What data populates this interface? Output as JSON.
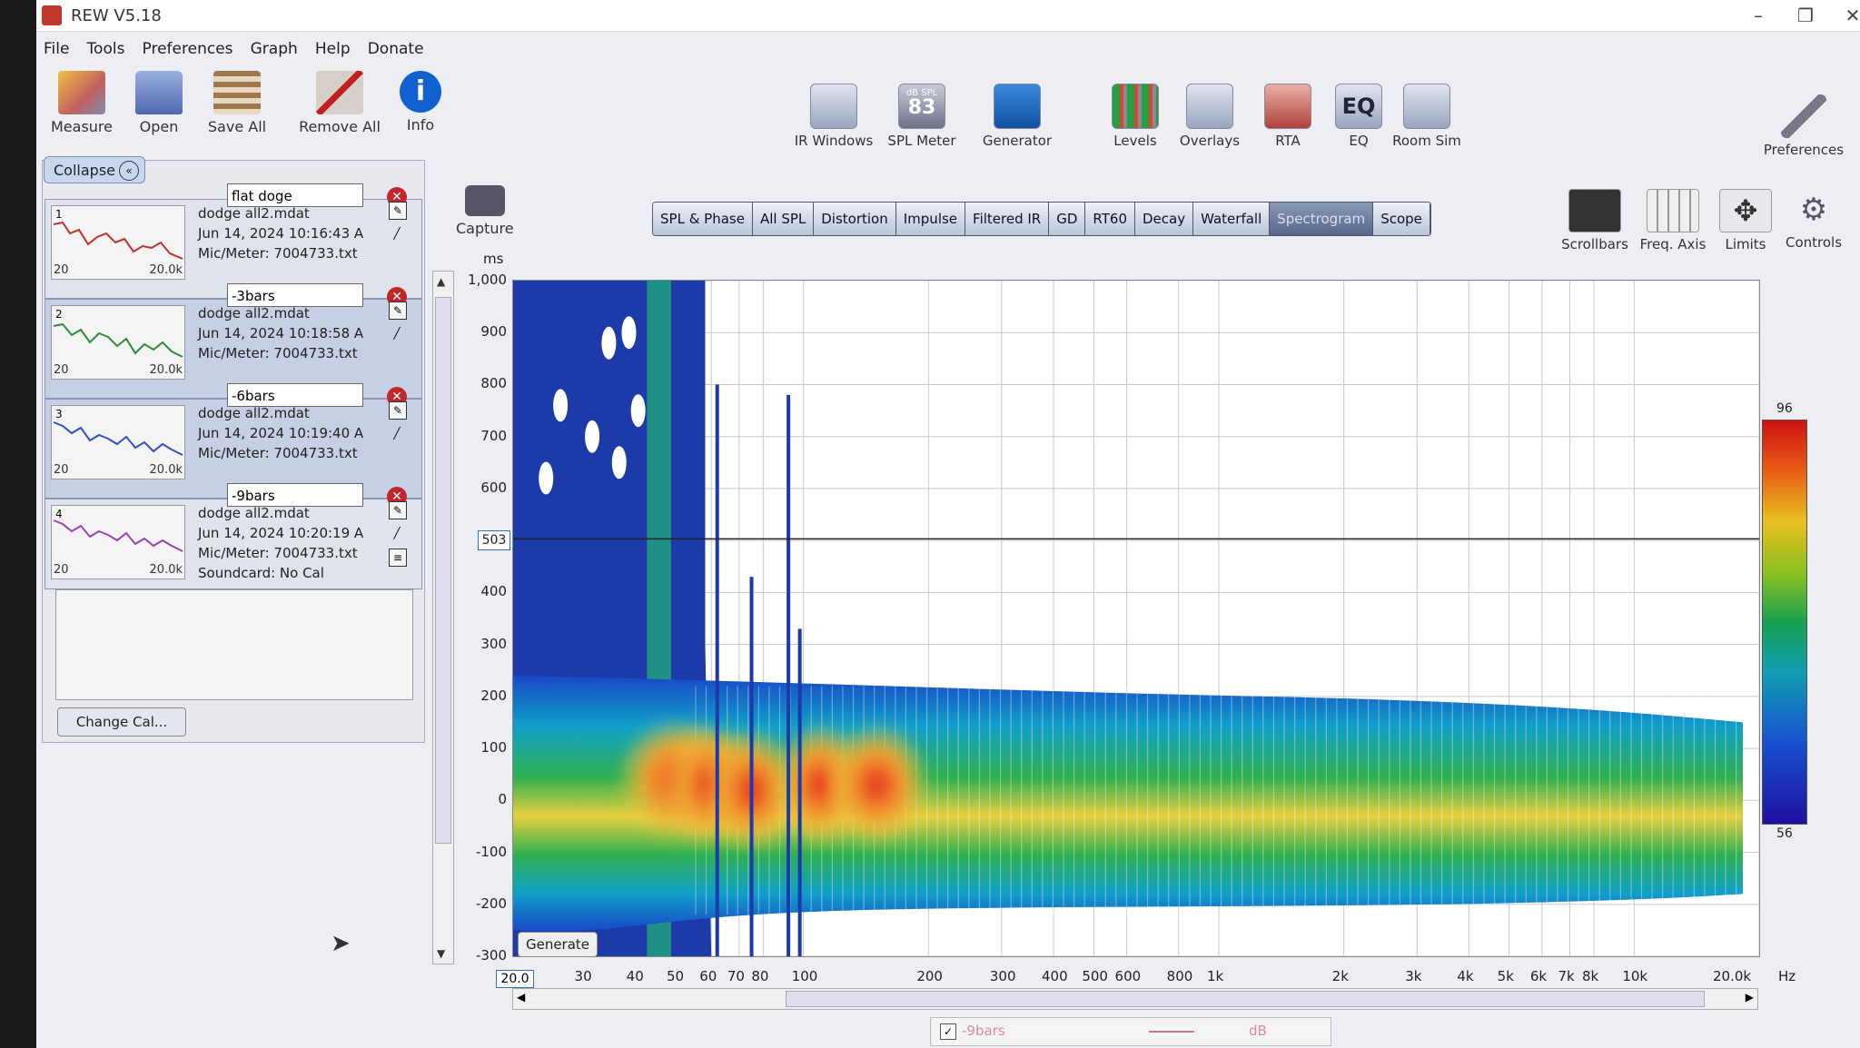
{
  "window": {
    "title": "REW V5.18"
  },
  "menu": [
    "File",
    "Tools",
    "Preferences",
    "Graph",
    "Help",
    "Donate"
  ],
  "toolbar_left": [
    {
      "label": "Measure",
      "icon": "measure-icon"
    },
    {
      "label": "Open",
      "icon": "folder-icon"
    },
    {
      "label": "Save All",
      "icon": "save-icon"
    },
    {
      "label": "Remove All",
      "icon": "remove-icon"
    },
    {
      "label": "Info",
      "icon": "info-icon"
    }
  ],
  "toolbar_tools": [
    {
      "label": "IR Windows",
      "icon": "ir-windows-icon"
    },
    {
      "label": "SPL Meter",
      "icon": "spl-meter-icon",
      "badge_top": "dB SPL",
      "badge_value": "83"
    },
    {
      "label": "Generator",
      "icon": "generator-icon"
    },
    {
      "label": "Levels",
      "icon": "levels-icon"
    },
    {
      "label": "Overlays",
      "icon": "overlays-icon"
    },
    {
      "label": "RTA",
      "icon": "rta-icon"
    },
    {
      "label": "EQ",
      "icon": "eq-icon",
      "badge_value": "EQ"
    },
    {
      "label": "Room Sim",
      "icon": "room-sim-icon"
    }
  ],
  "preferences_label": "Preferences",
  "collapse_label": "Collapse",
  "measurements": [
    {
      "num": "1",
      "name": "flat doge",
      "file": "dodge all2.mdat",
      "date": "Jun 14, 2024 10:16:43 A",
      "mic": "Mic/Meter: 7004733.txt",
      "trace": "#c03030",
      "xmin": "20",
      "xmax": "20.0k"
    },
    {
      "num": "2",
      "name": "-3bars",
      "file": "dodge all2.mdat",
      "date": "Jun 14, 2024 10:18:58 A",
      "mic": "Mic/Meter: 7004733.txt",
      "trace": "#2f8a3a",
      "xmin": "20",
      "xmax": "20.0k"
    },
    {
      "num": "3",
      "name": "-6bars",
      "file": "dodge all2.mdat",
      "date": "Jun 14, 2024 10:19:40 A",
      "mic": "Mic/Meter: 7004733.txt",
      "trace": "#3050c0",
      "xmin": "20",
      "xmax": "20.0k"
    },
    {
      "num": "4",
      "name": "-9bars",
      "file": "dodge all2.mdat",
      "date": "Jun 14, 2024 10:20:19 A",
      "mic": "Mic/Meter: 7004733.txt",
      "soundcard": "Soundcard: No Cal",
      "trace": "#9a40b0",
      "xmin": "20",
      "xmax": "20.0k"
    }
  ],
  "change_cal_label": "Change Cal...",
  "capture_label": "Capture",
  "graph_tabs": [
    {
      "label": "SPL & Phase",
      "active": false
    },
    {
      "label": "All SPL",
      "active": false
    },
    {
      "label": "Distortion",
      "active": false
    },
    {
      "label": "Impulse",
      "active": false
    },
    {
      "label": "Filtered IR",
      "active": false
    },
    {
      "label": "GD",
      "active": false
    },
    {
      "label": "RT60",
      "active": false
    },
    {
      "label": "Decay",
      "active": false
    },
    {
      "label": "Waterfall",
      "active": false
    },
    {
      "label": "Spectrogram",
      "active": true
    },
    {
      "label": "Scope",
      "active": false
    }
  ],
  "graph_controls": [
    {
      "label": "Scrollbars",
      "icon": "scrollbars-icon"
    },
    {
      "label": "Freq. Axis",
      "icon": "freq-axis-icon"
    },
    {
      "label": "Limits",
      "icon": "limits-icon"
    },
    {
      "label": "Controls",
      "icon": "gear-icon"
    }
  ],
  "generate_label": "Generate",
  "colors": {
    "accent": "#3070c0",
    "delete": "#c0262b",
    "active_tab": "#56668a"
  },
  "chart_data": {
    "type": "heatmap",
    "y_unit": "ms",
    "x_unit": "Hz",
    "x_scale": "log",
    "xlim": [
      20,
      20000
    ],
    "ylim": [
      -300,
      1000
    ],
    "y_ticks": [
      "1,000",
      "900",
      "800",
      "700",
      "600",
      "500",
      "400",
      "300",
      "200",
      "100",
      "0",
      "-100",
      "-200",
      "-300"
    ],
    "y_tick_values": [
      1000,
      900,
      800,
      700,
      600,
      500,
      400,
      300,
      200,
      100,
      0,
      -100,
      -200,
      -300
    ],
    "x_ticks": [
      "20.0",
      "30",
      "40",
      "50",
      "60",
      "70",
      "80",
      "100",
      "200",
      "300",
      "400",
      "500",
      "600",
      "800",
      "1k",
      "2k",
      "3k",
      "4k",
      "5k",
      "6k",
      "7k",
      "8k",
      "10k",
      "20.0k"
    ],
    "x_tick_values": [
      20,
      30,
      40,
      50,
      60,
      70,
      80,
      100,
      200,
      300,
      400,
      500,
      600,
      800,
      1000,
      2000,
      3000,
      4000,
      5000,
      6000,
      7000,
      8000,
      10000,
      20000
    ],
    "cursor_y": "503",
    "cursor_y_value": 503,
    "cursor_x": "20.0",
    "color_scale": {
      "max": "96",
      "min": "56"
    },
    "grid": true
  },
  "legend": {
    "name": "-9bars",
    "unit": "dB",
    "checked": true
  }
}
